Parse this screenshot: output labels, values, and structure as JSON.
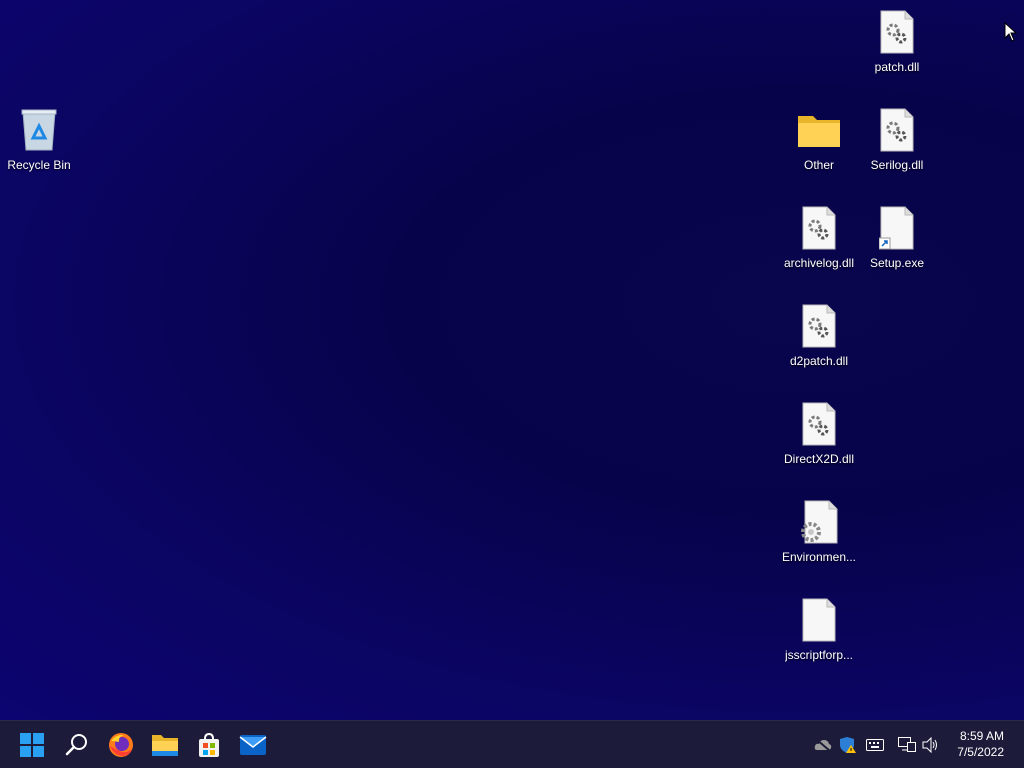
{
  "desktop": {
    "background_color": "#08045a",
    "icons": [
      {
        "id": "recycle-bin",
        "label": "Recycle Bin",
        "type": "recycle-bin-icon"
      },
      {
        "id": "patch-dll",
        "label": "patch.dll",
        "type": "dll-file-icon"
      },
      {
        "id": "other-folder",
        "label": "Other",
        "type": "folder-icon"
      },
      {
        "id": "serilog-dll",
        "label": "Serilog.dll",
        "type": "dll-file-icon"
      },
      {
        "id": "archivelog-dll",
        "label": "archivelog.dll",
        "type": "dll-file-icon"
      },
      {
        "id": "setup-exe",
        "label": "Setup.exe",
        "type": "shortcut-file-icon"
      },
      {
        "id": "d2patch-dll",
        "label": "d2patch.dll",
        "type": "dll-file-icon"
      },
      {
        "id": "directx2d-dll",
        "label": "DirectX2D.dll",
        "type": "dll-file-icon"
      },
      {
        "id": "environment",
        "label": "Environmen...",
        "type": "config-file-icon"
      },
      {
        "id": "jscriptforp",
        "label": "jsscriptforp...",
        "type": "blank-file-icon"
      }
    ]
  },
  "taskbar": {
    "background_color": "#1c1c3a",
    "pinned": [
      {
        "name": "start-button",
        "icon": "windows-logo-icon"
      },
      {
        "name": "search-button",
        "icon": "search-icon"
      },
      {
        "name": "firefox-button",
        "icon": "firefox-icon"
      },
      {
        "name": "file-explorer-button",
        "icon": "folder-icon"
      },
      {
        "name": "microsoft-store-button",
        "icon": "store-icon"
      },
      {
        "name": "mail-button",
        "icon": "mail-icon"
      }
    ],
    "tray": {
      "icons": [
        "onedrive-offline-icon",
        "security-warning-icon",
        "keyboard-icon",
        "network-icon",
        "volume-icon"
      ],
      "time": "8:59 AM",
      "date": "7/5/2022"
    }
  }
}
